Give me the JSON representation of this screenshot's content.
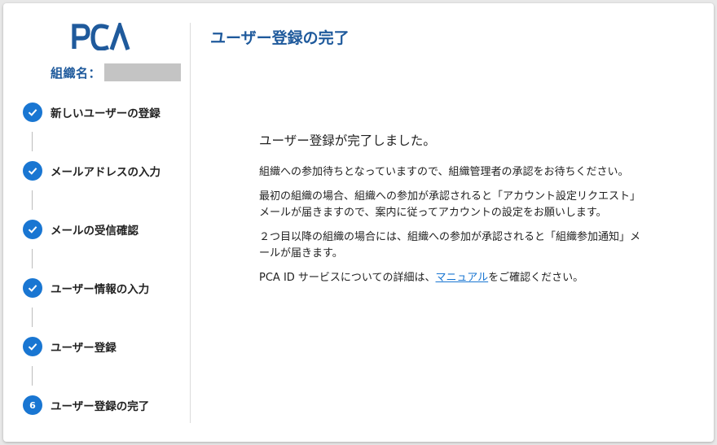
{
  "brand": {
    "logo_text": "PCA",
    "color": "#1f5a9c"
  },
  "sidebar": {
    "org_label": "組織名：",
    "steps": [
      {
        "label": "新しいユーザーの登録",
        "status": "done",
        "icon": "check-icon"
      },
      {
        "label": "メールアドレスの入力",
        "status": "done",
        "icon": "check-icon"
      },
      {
        "label": "メールの受信確認",
        "status": "done",
        "icon": "check-icon"
      },
      {
        "label": "ユーザー情報の入力",
        "status": "done",
        "icon": "check-icon"
      },
      {
        "label": "ユーザー登録",
        "status": "done",
        "icon": "check-icon"
      },
      {
        "label": "ユーザー登録の完了",
        "status": "current",
        "number": "6"
      }
    ]
  },
  "main": {
    "title": "ユーザー登録の完了",
    "headline": "ユーザー登録が完了しました。",
    "paragraphs": [
      "組織への参加待ちとなっていますので、組織管理者の承認をお待ちください。",
      "最初の組織の場合、組織への参加が承認されると「アカウント設定リクエスト」メールが届きますので、案内に従ってアカウントの設定をお願いします。",
      "２つ目以降の組織の場合には、組織への参加が承認されると「組織参加通知」メールが届きます。"
    ],
    "info_prefix": "PCA ID サービスについての詳細は、",
    "manual_link": "マニュアル",
    "info_suffix": "をご確認ください。"
  },
  "colors": {
    "accent": "#1976d2",
    "title": "#1f5a9c"
  }
}
